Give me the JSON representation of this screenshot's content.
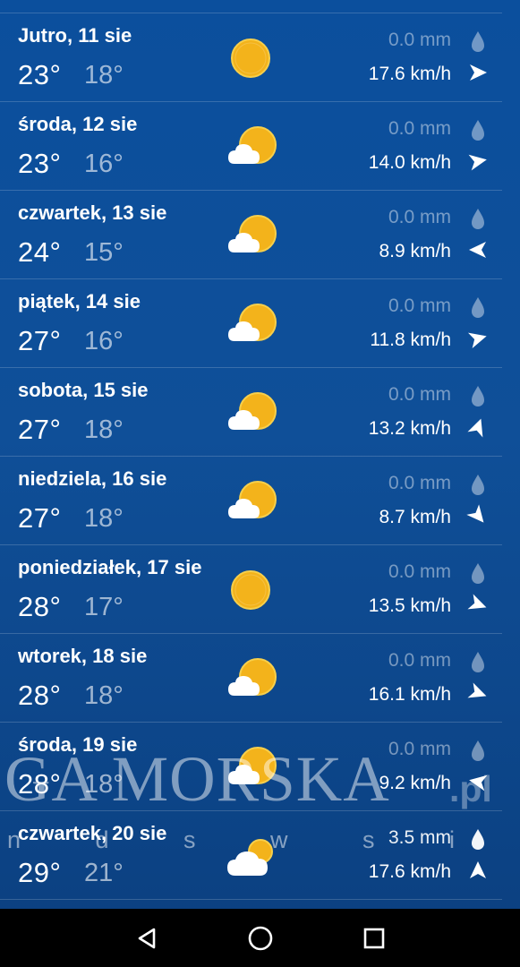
{
  "forecast": [
    {
      "day": "Jutro, 11 sie",
      "max": "23°",
      "min": "18°",
      "icon": "sun-icon",
      "precip": "0.0 mm",
      "wind": "17.6 km/h",
      "wind_dir_deg": 90
    },
    {
      "day": "środa, 12 sie",
      "max": "23°",
      "min": "16°",
      "icon": "partly-cloudy-icon",
      "precip": "0.0 mm",
      "wind": "14.0 km/h",
      "wind_dir_deg": 80
    },
    {
      "day": "czwartek, 13 sie",
      "max": "24°",
      "min": "15°",
      "icon": "partly-cloudy-icon",
      "precip": "0.0 mm",
      "wind": "8.9 km/h",
      "wind_dir_deg": 270
    },
    {
      "day": "piątek, 14 sie",
      "max": "27°",
      "min": "16°",
      "icon": "partly-cloudy-icon",
      "precip": "0.0 mm",
      "wind": "11.8 km/h",
      "wind_dir_deg": 75
    },
    {
      "day": "sobota, 15 sie",
      "max": "27°",
      "min": "18°",
      "icon": "partly-cloudy-icon",
      "precip": "0.0 mm",
      "wind": "13.2 km/h",
      "wind_dir_deg": 20
    },
    {
      "day": "niedziela, 16 sie",
      "max": "27°",
      "min": "18°",
      "icon": "partly-cloudy-icon",
      "precip": "0.0 mm",
      "wind": "8.7 km/h",
      "wind_dir_deg": 140
    },
    {
      "day": "poniedziałek, 17 sie",
      "max": "28°",
      "min": "17°",
      "icon": "sun-icon",
      "precip": "0.0 mm",
      "wind": "13.5 km/h",
      "wind_dir_deg": 110
    },
    {
      "day": "wtorek, 18 sie",
      "max": "28°",
      "min": "18°",
      "icon": "partly-cloudy-icon",
      "precip": "0.0 mm",
      "wind": "16.1 km/h",
      "wind_dir_deg": 110
    },
    {
      "day": "środa, 19 sie",
      "max": "28°",
      "min": "18°",
      "icon": "partly-cloudy-icon",
      "precip": "0.0 mm",
      "wind": "9.2 km/h",
      "wind_dir_deg": 280
    },
    {
      "day": "czwartek, 20 sie",
      "max": "29°",
      "min": "21°",
      "icon": "cloudy-sun-icon",
      "precip": "3.5 mm",
      "precip_active": true,
      "wind": "17.6 km/h",
      "wind_dir_deg": 0
    }
  ],
  "watermark": {
    "main": "GA MORSKA",
    "tld": ".pl",
    "sub": "n d s w s i e"
  },
  "navigation": {
    "back_icon": "back-triangle-icon",
    "home_icon": "home-circle-icon",
    "recent_icon": "recent-square-icon"
  },
  "colors": {
    "background": "#0b4f9d",
    "sun": "#f3b31b",
    "cloud": "#ffffff"
  }
}
